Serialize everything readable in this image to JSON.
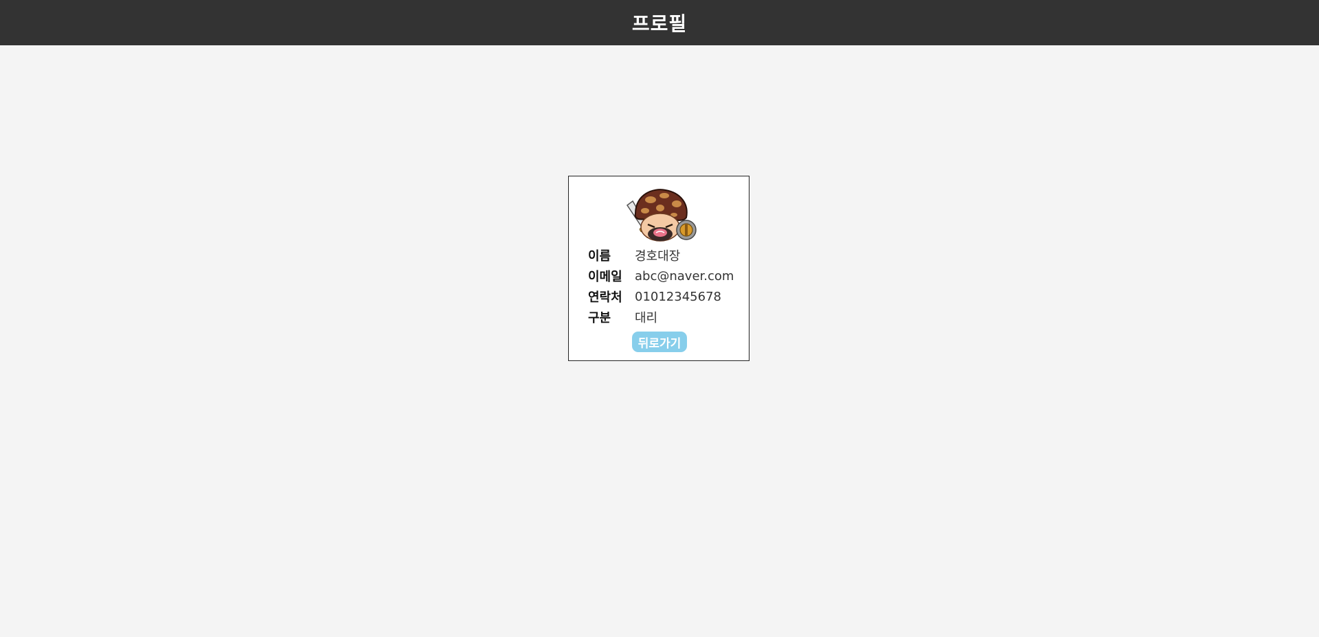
{
  "header": {
    "title": "프로필"
  },
  "profile": {
    "avatar_icon": "mushroom-warrior-icon",
    "fields": [
      {
        "label": "이름",
        "value": "경호대장"
      },
      {
        "label": "이메일",
        "value": "abc@naver.com"
      },
      {
        "label": "연락처",
        "value": "01012345678"
      },
      {
        "label": "구분",
        "value": "대리"
      }
    ],
    "back_label": "뒤로가기"
  },
  "colors": {
    "header_bg": "#333333",
    "page_bg": "#f4f4f4",
    "button_bg": "#87ceeb"
  }
}
